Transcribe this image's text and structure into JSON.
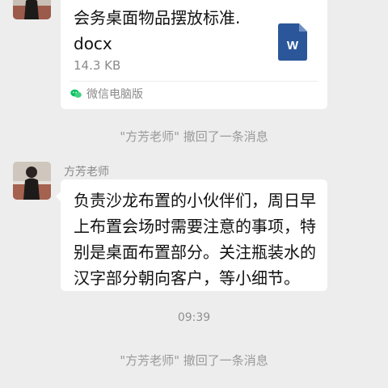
{
  "messages": {
    "file": {
      "name_line1": "会务桌面物品摆放标准.",
      "name_line2": "docx",
      "size": "14.3 KB",
      "source": "微信电脑版",
      "file_icon": "word-doc-icon",
      "source_icon": "wechat-icon",
      "word_icon_color": "#2b579a"
    },
    "recall_notice_1": "\"方芳老师\" 撤回了一条消息",
    "sender": "方芳老师",
    "text_lines": [
      "负责沙龙布置的小伙伴们，周日早",
      "上布置会场时需要注意的事项，特",
      "别是桌面布置部分。关注瓶装水的",
      "汉字部分朝向客户，等小细节。"
    ],
    "time": "09:39",
    "recall_notice_2": "\"方芳老师\" 撤回了一条消息"
  },
  "colors": {
    "background": "#ededed",
    "bubble": "#ffffff",
    "secondary_text": "#8a8a8a",
    "wechat_green": "#07c160"
  }
}
